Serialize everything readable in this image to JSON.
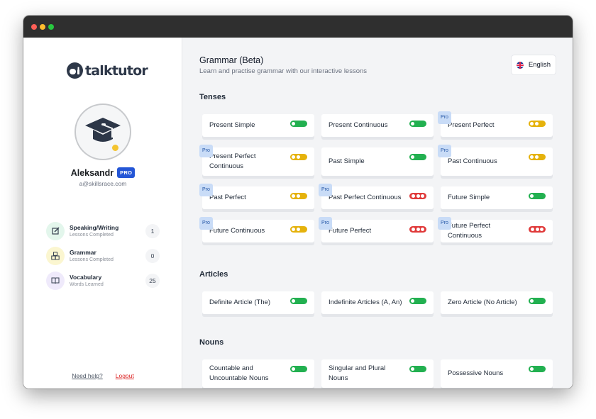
{
  "app": {
    "name": "talktutor"
  },
  "user": {
    "name": "Aleksandr",
    "badge": "PRO",
    "email": "a@skillsrace.com"
  },
  "stats": [
    {
      "title": "Speaking/Writing",
      "subtitle": "Lessons Completed",
      "count": "1",
      "icon": "edit-icon",
      "color": "#e3f6ec"
    },
    {
      "title": "Grammar",
      "subtitle": "Lessons Completed",
      "count": "0",
      "icon": "blocks-icon",
      "color": "#fbf6d0"
    },
    {
      "title": "Vocabulary",
      "subtitle": "Words Learned",
      "count": "25",
      "icon": "book-icon",
      "color": "#efeafb"
    }
  ],
  "footer": {
    "help": "Need help?",
    "logout": "Logout"
  },
  "header": {
    "title": "Grammar (Beta)",
    "subtitle": "Learn and practise grammar with our interactive lessons",
    "language": "English"
  },
  "pro_label": "Pro",
  "level_colors": {
    "easy": "#22b050",
    "medium": "#e5b20c",
    "hard": "#e03a3a"
  },
  "sections": [
    {
      "title": "Tenses",
      "lessons": [
        {
          "label": "Present Simple",
          "pro": false,
          "level": "easy"
        },
        {
          "label": "Present Continuous",
          "pro": false,
          "level": "easy"
        },
        {
          "label": "Present Perfect",
          "pro": true,
          "level": "medium"
        },
        {
          "label": "Present Perfect Continuous",
          "pro": true,
          "level": "medium"
        },
        {
          "label": "Past Simple",
          "pro": false,
          "level": "easy"
        },
        {
          "label": "Past Continuous",
          "pro": true,
          "level": "medium"
        },
        {
          "label": "Past Perfect",
          "pro": true,
          "level": "medium"
        },
        {
          "label": "Past Perfect Continuous",
          "pro": true,
          "level": "hard"
        },
        {
          "label": "Future Simple",
          "pro": false,
          "level": "easy"
        },
        {
          "label": "Future Continuous",
          "pro": true,
          "level": "medium"
        },
        {
          "label": "Future Perfect",
          "pro": true,
          "level": "hard"
        },
        {
          "label": "Future Perfect Continuous",
          "pro": true,
          "level": "hard"
        }
      ]
    },
    {
      "title": "Articles",
      "lessons": [
        {
          "label": "Definite Article (The)",
          "pro": false,
          "level": "easy"
        },
        {
          "label": "Indefinite Articles (A, An)",
          "pro": false,
          "level": "easy"
        },
        {
          "label": "Zero Article (No Article)",
          "pro": false,
          "level": "easy"
        }
      ]
    },
    {
      "title": "Nouns",
      "lessons": [
        {
          "label": "Countable and Uncountable Nouns",
          "pro": false,
          "level": "easy"
        },
        {
          "label": "Singular and Plural Nouns",
          "pro": false,
          "level": "easy"
        },
        {
          "label": "Possessive Nouns",
          "pro": false,
          "level": "easy"
        }
      ]
    }
  ]
}
